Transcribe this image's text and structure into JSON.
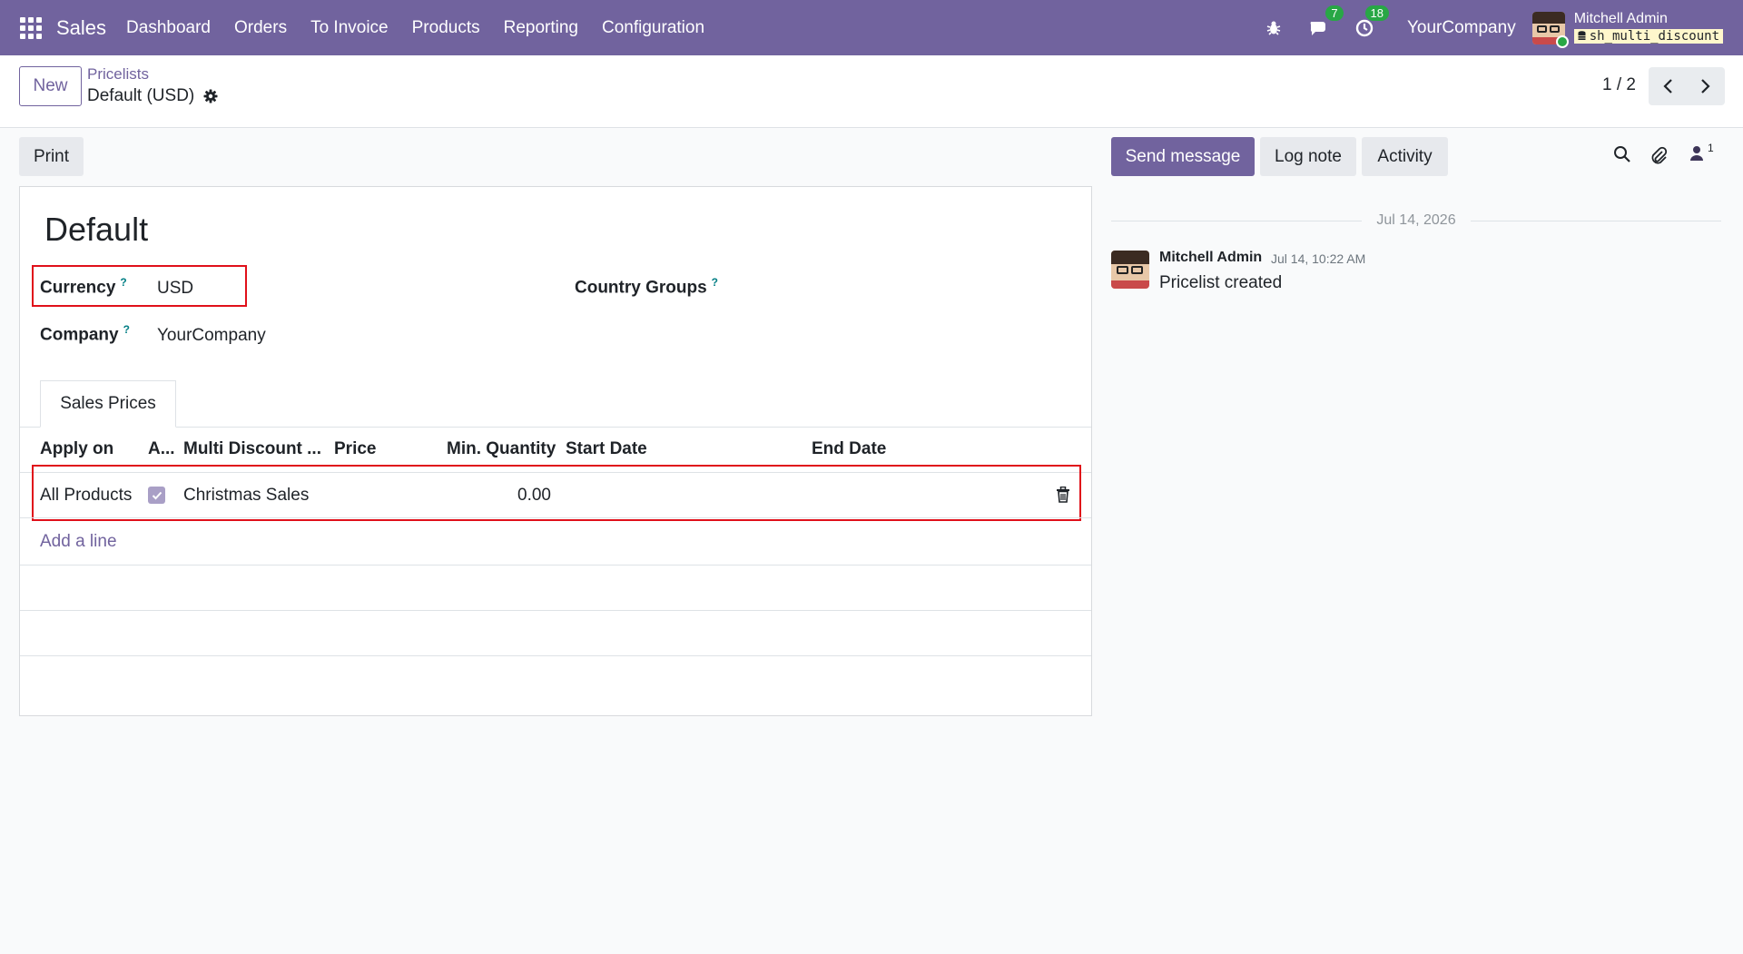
{
  "app": {
    "name": "Sales",
    "menu": [
      "Dashboard",
      "Orders",
      "To Invoice",
      "Products",
      "Reporting",
      "Configuration"
    ]
  },
  "systray": {
    "messages_count": "7",
    "activities_count": "18",
    "company": "YourCompany",
    "user_name": "Mitchell Admin",
    "database": "sh_multi_discount"
  },
  "control_panel": {
    "new_label": "New",
    "breadcrumb_parent": "Pricelists",
    "breadcrumb_current": "Default (USD)",
    "pager": "1 / 2"
  },
  "form": {
    "print_label": "Print",
    "title": "Default",
    "fields": {
      "currency_label": "Currency",
      "currency_value": "USD",
      "company_label": "Company",
      "company_value": "YourCompany",
      "country_groups_label": "Country Groups",
      "help_mark": "?"
    },
    "tab_label": "Sales Prices",
    "table": {
      "columns": [
        "Apply on",
        "A...",
        "Multi Discount ...",
        "Price",
        "Min. Quantity",
        "Start Date",
        "End Date"
      ],
      "rows": [
        {
          "apply_on": "All Products",
          "checked": true,
          "multi_discount": "Christmas Sales",
          "price": "",
          "min_quantity": "0.00",
          "start_date": "",
          "end_date": ""
        }
      ],
      "add_line_label": "Add a line"
    }
  },
  "chatter": {
    "send_message_label": "Send message",
    "log_note_label": "Log note",
    "activity_label": "Activity",
    "followers_count": "1",
    "date_separator": "Jul 14, 2026",
    "messages": [
      {
        "author": "Mitchell Admin",
        "date": "Jul 14, 10:22 AM",
        "body": "Pricelist created"
      }
    ]
  },
  "colors": {
    "brand": "#71639e",
    "badge": "#28a745",
    "highlight": "#e0101a",
    "help": "#017e84"
  }
}
